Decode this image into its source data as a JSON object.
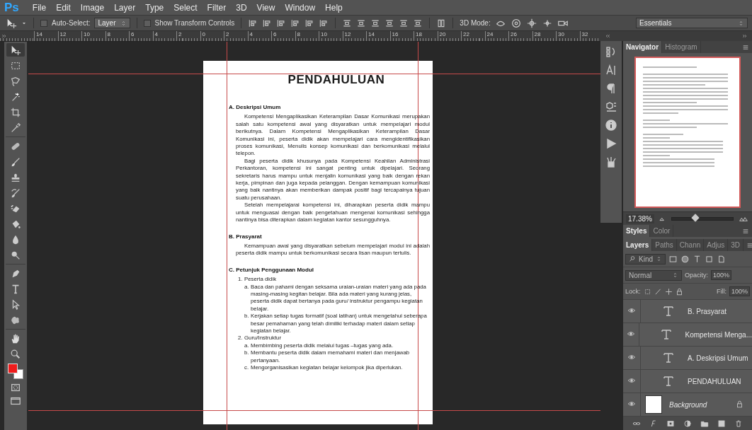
{
  "app_logo": "Ps",
  "menu": [
    "File",
    "Edit",
    "Image",
    "Layer",
    "Type",
    "Select",
    "Filter",
    "3D",
    "View",
    "Window",
    "Help"
  ],
  "options_bar": {
    "auto_select": {
      "label": "Auto-Select:",
      "checked": false
    },
    "target": "Layer",
    "transform_controls": {
      "label": "Show Transform Controls",
      "checked": false
    },
    "mode_label": "3D Mode:",
    "workspace": "Essentials"
  },
  "ruler": [
    "14",
    "12",
    "10",
    "8",
    "6",
    "4",
    "2",
    "0",
    "2",
    "4",
    "6",
    "8",
    "10",
    "12",
    "14",
    "16",
    "18",
    "20",
    "22",
    "24",
    "26",
    "28",
    "30",
    "32"
  ],
  "tools": [
    {
      "selected": true
    },
    {
      "selected": false
    },
    {
      "selected": false
    },
    {
      "selected": false
    },
    {
      "selected": false
    },
    {
      "selected": false
    },
    {
      "selected": false
    },
    {
      "selected": false
    },
    {
      "selected": false
    },
    {
      "selected": false
    },
    {
      "selected": false
    },
    {
      "selected": false
    },
    {
      "selected": false
    },
    {
      "selected": false
    },
    {
      "selected": false
    },
    {
      "selected": false
    },
    {
      "selected": false
    },
    {
      "selected": false
    },
    {
      "selected": false
    },
    {
      "selected": false
    }
  ],
  "document": {
    "title": "PENDAHULUAN",
    "sections": [
      {
        "heading": "A. Deskripsi Umum",
        "paragraphs": [
          "Kompetensi Mengaplikasikan Keterampilan Dasar Komunikasi merupakan salah satu kompetensi awal yang disyaratkan untuk mempelajari modul berikutnya. Dalam Kompetensi Mengaplikasikan Keterampilan Dasar Komunikasi ini, peserta didik akan mempelajari cara mengidentifikasikan proses komunikasi, Menulis konsep komunikasi dan berkomunikasi melalui telepon.",
          "Bagi peserta didik khusunya pada Kompetensi Keahlian Administrasi Perkantoran, kompetensi ini sangat penting untuk dipelajari. Seorang sekretaris harus mampu untuk menjalin komunikasi yang baik dengan rekan kerja, pimpinan dan juga kepada pelanggan. Dengan kemampuan komunikasi yang baik nantinya akan memberikan dampak positif bagi tercapainya tujuan suatu perusahaan.",
          "Setelah mempelajarai kompetensi ini, diharapkan peserta didik mampu untuk menguasai dengan baik pengetahuan mengenai komunikasi sehingga nantinya bisa diterapkan dalam kegiatan kantor sesungguhnya."
        ]
      },
      {
        "heading": "B. Prasyarat",
        "paragraphs": [
          "Kemampuan awal yang disyaratkan sebelum mempelajari modul ini adalah peserta didik mampu untuk berkomunikasi secara lisan maupun tertulis."
        ]
      },
      {
        "heading": "C. Petunjuk Penggunaan Modul",
        "list": [
          {
            "marker": "1.",
            "text": "Peserta didik",
            "children": [
              {
                "marker": "a.",
                "text": "Baca dan pahami dengan seksama uraian-uraian materi yang ada pada masing-masing kegitan belajar. Bila ada materi yang kurang jelas, peserta didik dapat bertanya pada guru/ instruktur pengampu kegiatan belajar."
              },
              {
                "marker": "b.",
                "text": "Kerjakan setiap tugas formatif (soal latihan) untuk mengetahui seberapa besar pemahaman yang telah dimiliki terhadap materi dalam setiap kegiatan belajar."
              }
            ]
          },
          {
            "marker": "2.",
            "text": "Guru/Instruktur",
            "children": [
              {
                "marker": "a.",
                "text": "Membimbing peserta didik melalui tugas –tugas yang ada."
              },
              {
                "marker": "b.",
                "text": "Membantu peserta didik dalam memahami materi dan menjawab pertanyaan."
              },
              {
                "marker": "c.",
                "text": "Mengorganisasikan kegiatan belajar kelompok jika diperlukan."
              }
            ]
          }
        ]
      }
    ]
  },
  "navigator": {
    "tabs": [
      {
        "label": "Navigator",
        "selected": true
      },
      {
        "label": "Histogram",
        "selected": false
      }
    ],
    "zoom": "17.38%",
    "level": 0.38
  },
  "style_tabs": [
    {
      "label": "Styles",
      "selected": true
    },
    {
      "label": "Color",
      "selected": false
    }
  ],
  "layer_tabs": [
    {
      "label": "Layers",
      "selected": true
    },
    {
      "label": "Paths",
      "selected": false
    },
    {
      "label": "Chann",
      "selected": false
    },
    {
      "label": "Adjus",
      "selected": false
    },
    {
      "label": "3D",
      "selected": false
    }
  ],
  "layers_panel": {
    "filter": "Kind",
    "blend_mode": "Normal",
    "opacity_label": "Opacity:",
    "opacity": "100%",
    "lock_label": "Lock:",
    "fill_label": "Fill:",
    "fill": "100%",
    "layers": [
      {
        "name": "B. Prasyarat",
        "kind": "text",
        "visible": true,
        "locked": false
      },
      {
        "name": "Kompetensi Menga...",
        "kind": "text",
        "visible": true,
        "locked": false
      },
      {
        "name": "A. Deskripsi Umum",
        "kind": "text",
        "visible": true,
        "locked": false
      },
      {
        "name": "PENDAHULUAN",
        "kind": "text",
        "visible": true,
        "locked": false
      },
      {
        "name": "Background",
        "kind": "image",
        "visible": true,
        "locked": true
      }
    ]
  }
}
